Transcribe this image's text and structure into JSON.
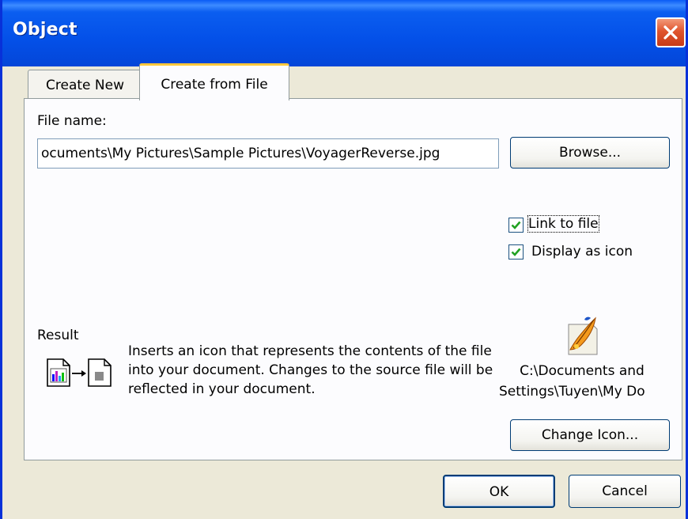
{
  "window": {
    "title": "Object"
  },
  "tabs": [
    {
      "label": "Create New",
      "accesskey": "C"
    },
    {
      "label": "Create from File",
      "accesskey": "F"
    }
  ],
  "form": {
    "file_name_label": "File name:",
    "file_name_value": "ocuments\\My Pictures\\Sample Pictures\\VoyagerReverse.jpg",
    "browse_label": "Browse...",
    "link_to_file_label": "Link to file",
    "link_to_file_checked": true,
    "display_as_icon_label": "Display as icon",
    "display_as_icon_checked": true
  },
  "result": {
    "heading": "Result",
    "description": "Inserts an icon that represents the contents of the file into your document.  Changes to the source file will be reflected in your document.",
    "icon_path_line1": "C:\\Documents and",
    "icon_path_line2": "Settings\\Tuyen\\My Do",
    "change_icon_label": "Change Icon..."
  },
  "buttons": {
    "ok": "OK",
    "cancel": "Cancel"
  },
  "icons": {
    "close": "close-icon",
    "check": "checkmark-icon",
    "document": "document-icon",
    "arrow": "arrow-right-icon",
    "picture": "picture-file-icon"
  },
  "colors": {
    "titlebar": "#0450e8",
    "face": "#ece9d8",
    "close": "#e0552e",
    "check": "#21a121",
    "tab_highlight": "#ffc83c"
  }
}
